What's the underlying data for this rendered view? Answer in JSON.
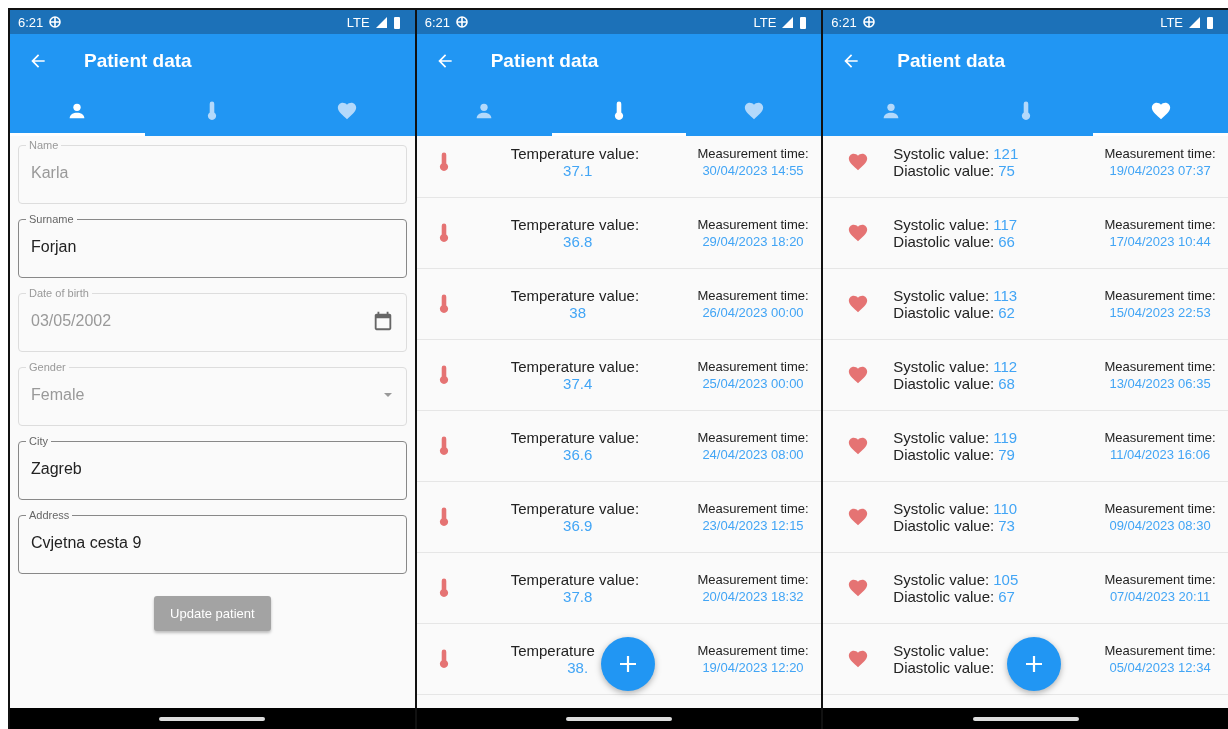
{
  "screens": [
    {
      "kind": "form",
      "status_bar": {
        "time": "6:21",
        "network": "LTE"
      },
      "app_bar": {
        "title": "Patient data"
      },
      "tabs": [
        {
          "selected": true
        },
        {
          "selected": false
        },
        {
          "selected": false
        }
      ],
      "fields": [
        {
          "kind": "text",
          "label": "Name",
          "value": "Karla",
          "disabled": true
        },
        {
          "kind": "text",
          "label": "Surname",
          "value": "Forjan",
          "disabled": false
        },
        {
          "kind": "date",
          "label": "Date of birth",
          "value": "03/05/2002",
          "disabled": true
        },
        {
          "kind": "dropdown",
          "label": "Gender",
          "value": "Female",
          "disabled": true
        },
        {
          "kind": "text",
          "label": "City",
          "value": "Zagreb",
          "disabled": false
        },
        {
          "kind": "text",
          "label": "Address",
          "value": "Cvjetna cesta 9",
          "disabled": false
        }
      ],
      "button": {
        "label": "Update patient",
        "disabled": true
      }
    },
    {
      "kind": "temperature",
      "status_bar": {
        "time": "6:21",
        "network": "LTE"
      },
      "app_bar": {
        "title": "Patient data"
      },
      "tabs": [
        {
          "selected": false
        },
        {
          "selected": true
        },
        {
          "selected": false
        }
      ],
      "rows": [
        {
          "label": "Temperature value:",
          "value": "37.1",
          "time_label": "Measurement time:",
          "time": "30/04/2023 14:55"
        },
        {
          "label": "Temperature value:",
          "value": "36.8",
          "time_label": "Measurement time:",
          "time": "29/04/2023 18:20"
        },
        {
          "label": "Temperature value:",
          "value": "38",
          "time_label": "Measurement time:",
          "time": "26/04/2023 00:00"
        },
        {
          "label": "Temperature value:",
          "value": "37.4",
          "time_label": "Measurement time:",
          "time": "25/04/2023 00:00"
        },
        {
          "label": "Temperature value:",
          "value": "36.6",
          "time_label": "Measurement time:",
          "time": "24/04/2023 08:00"
        },
        {
          "label": "Temperature value:",
          "value": "36.9",
          "time_label": "Measurement time:",
          "time": "23/04/2023 12:15"
        },
        {
          "label": "Temperature value:",
          "value": "37.8",
          "time_label": "Measurement time:",
          "time": "20/04/2023 18:32"
        },
        {
          "label": "Temperature",
          "value": "38.",
          "time_label": "Measurement time:",
          "time": "19/04/2023 12:20"
        }
      ],
      "fab": true
    },
    {
      "kind": "blood_pressure",
      "status_bar": {
        "time": "6:21",
        "network": "LTE"
      },
      "app_bar": {
        "title": "Patient data"
      },
      "tabs": [
        {
          "selected": false
        },
        {
          "selected": false
        },
        {
          "selected": true
        }
      ],
      "rows": [
        {
          "systolic_label": "Systolic value:",
          "systolic": "121",
          "diastolic_label": "Diastolic value:",
          "diastolic": "75",
          "time_label": "Measurement time:",
          "time": "19/04/2023 07:37"
        },
        {
          "systolic_label": "Systolic value:",
          "systolic": "117",
          "diastolic_label": "Diastolic value:",
          "diastolic": "66",
          "time_label": "Measurement time:",
          "time": "17/04/2023 10:44"
        },
        {
          "systolic_label": "Systolic value:",
          "systolic": "113",
          "diastolic_label": "Diastolic value:",
          "diastolic": "62",
          "time_label": "Measurement time:",
          "time": "15/04/2023 22:53"
        },
        {
          "systolic_label": "Systolic value:",
          "systolic": "112",
          "diastolic_label": "Diastolic value:",
          "diastolic": "68",
          "time_label": "Measurement time:",
          "time": "13/04/2023 06:35"
        },
        {
          "systolic_label": "Systolic value:",
          "systolic": "119",
          "diastolic_label": "Diastolic value:",
          "diastolic": "79",
          "time_label": "Measurement time:",
          "time": "11/04/2023 16:06"
        },
        {
          "systolic_label": "Systolic value:",
          "systolic": "110",
          "diastolic_label": "Diastolic value:",
          "diastolic": "73",
          "time_label": "Measurement time:",
          "time": "09/04/2023 08:30"
        },
        {
          "systolic_label": "Systolic value:",
          "systolic": "105",
          "diastolic_label": "Diastolic value:",
          "diastolic": "67",
          "time_label": "Measurement time:",
          "time": "07/04/2023 20:11"
        },
        {
          "systolic_label": "Systolic value:",
          "diastolic_label": "Diastolic value:",
          "time_label": "Measurement time:",
          "time": "05/04/2023 12:34"
        }
      ],
      "fab": true
    }
  ]
}
